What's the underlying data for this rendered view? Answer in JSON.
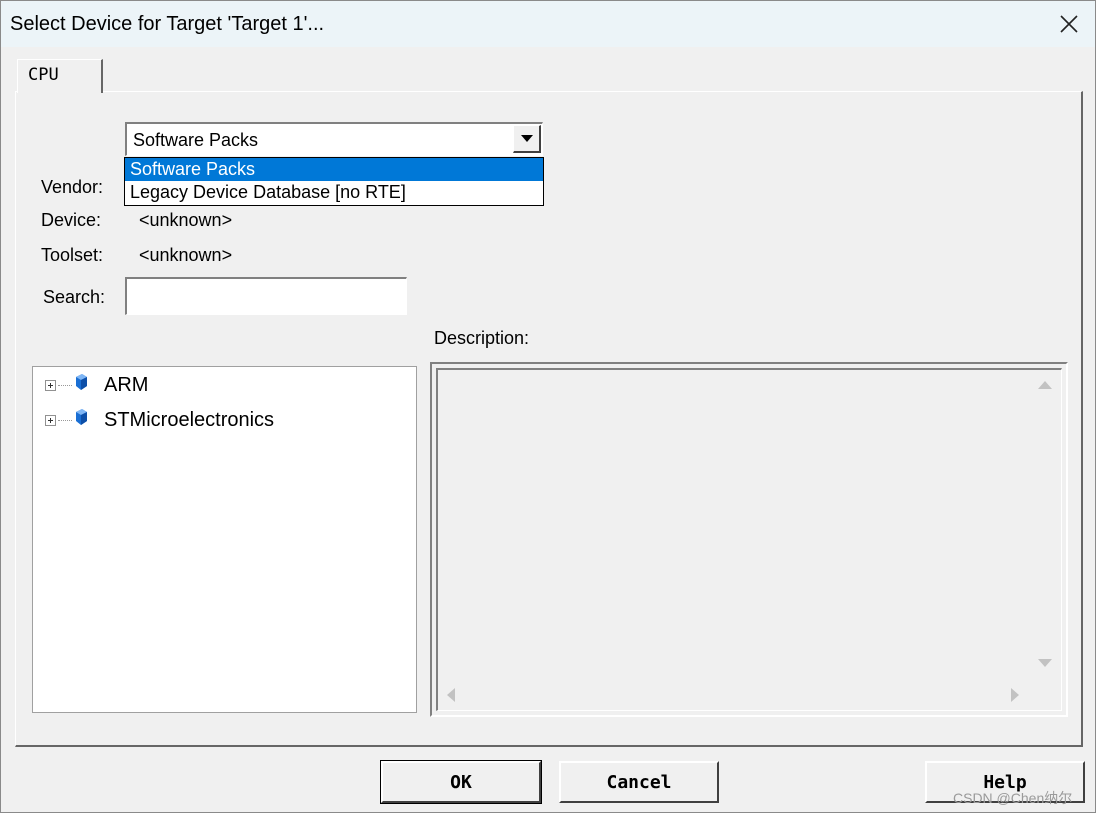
{
  "window": {
    "title": "Select Device for Target 'Target 1'..."
  },
  "tabs": [
    {
      "label": "CPU"
    }
  ],
  "database_combo": {
    "value": "Software Packs",
    "options": [
      "Software Packs",
      "Legacy Device Database [no RTE]"
    ]
  },
  "fields": {
    "vendor_label": "Vendor:",
    "device_label": "Device:",
    "device_value": "<unknown>",
    "toolset_label": "Toolset:",
    "toolset_value": "<unknown>",
    "search_label": "Search:",
    "search_value": ""
  },
  "tree": {
    "items": [
      {
        "label": "ARM",
        "icon": "device-gem-icon"
      },
      {
        "label": "STMicroelectronics",
        "icon": "device-gem-icon"
      }
    ]
  },
  "description": {
    "label": "Description:",
    "text": ""
  },
  "buttons": {
    "ok": "OK",
    "cancel": "Cancel",
    "help": "Help"
  },
  "watermark": "CSDN @Chen纳尔",
  "colors": {
    "selection": "#0078d7",
    "gem": "#1a6fd4"
  }
}
